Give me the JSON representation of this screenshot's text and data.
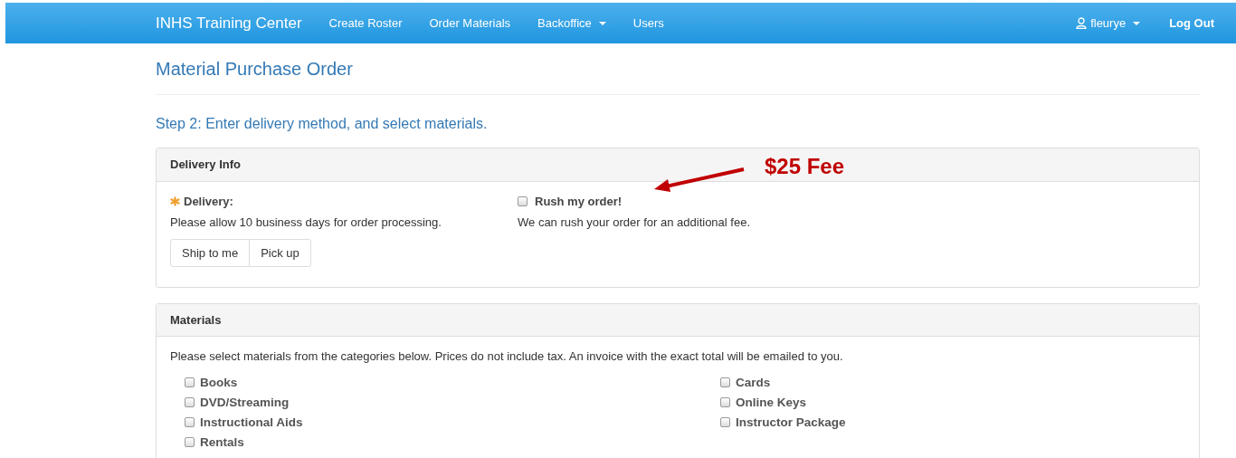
{
  "navbar": {
    "brand": "INHS Training Center",
    "links": [
      {
        "label": "Create Roster",
        "dropdown": false
      },
      {
        "label": "Order Materials",
        "dropdown": false
      },
      {
        "label": "Backoffice",
        "dropdown": true
      },
      {
        "label": "Users",
        "dropdown": false
      }
    ],
    "user": {
      "label": "fleurye",
      "dropdown": true
    },
    "logout": "Log Out"
  },
  "page_title": "Material Purchase Order",
  "step_heading": "Step 2: Enter delivery method, and select materials.",
  "delivery_panel": {
    "title": "Delivery Info",
    "delivery_label": "Delivery:",
    "required": true,
    "delivery_note": "Please allow 10 business days for order processing.",
    "methods": [
      {
        "label": "Ship to me",
        "selected": false
      },
      {
        "label": "Pick up",
        "selected": false
      }
    ],
    "rush": {
      "label": "Rush my order!",
      "checked": false,
      "note": "We can rush your order for an additional fee."
    }
  },
  "annotation": {
    "text": "$25 Fee"
  },
  "materials_panel": {
    "title": "Materials",
    "intro": "Please select materials from the categories below. Prices do not include tax. An invoice with the exact total will be emailed to you.",
    "columns": [
      [
        {
          "label": "Books",
          "checked": false
        },
        {
          "label": "DVD/Streaming",
          "checked": false
        },
        {
          "label": "Instructional Aids",
          "checked": false
        },
        {
          "label": "Rentals",
          "checked": false
        }
      ],
      [
        {
          "label": "Cards",
          "checked": false
        },
        {
          "label": "Online Keys",
          "checked": false
        },
        {
          "label": "Instructor Package",
          "checked": false
        }
      ]
    ]
  }
}
